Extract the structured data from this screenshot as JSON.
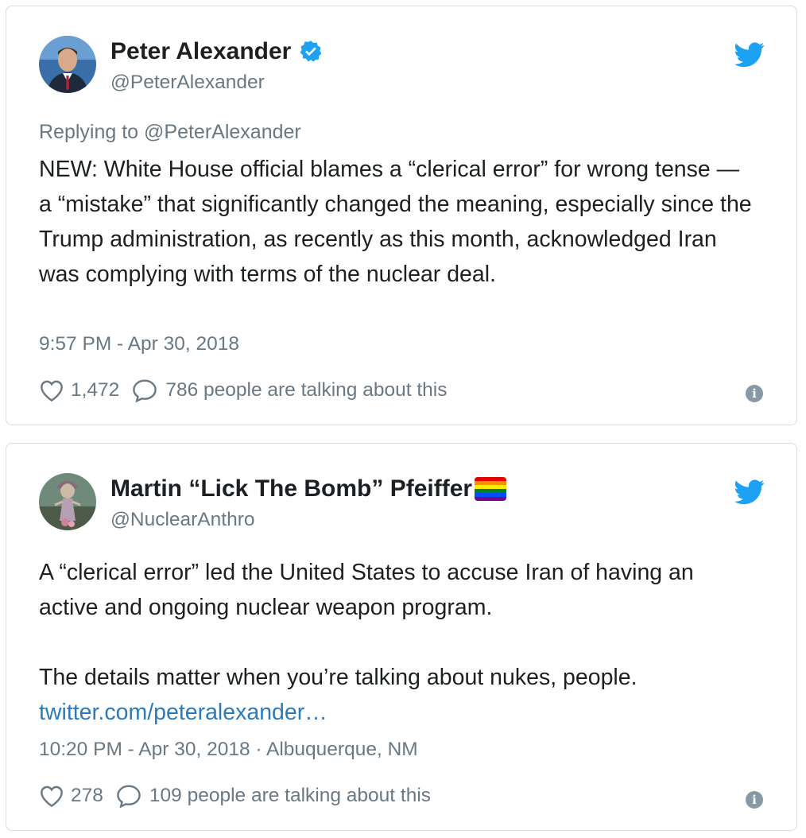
{
  "colors": {
    "twitter_blue": "#1da1f2",
    "verified_blue": "#1da1f2",
    "link": "#2b7bb9",
    "muted": "#697882",
    "text": "#1c2022",
    "border": "#d9dde0"
  },
  "tweets": [
    {
      "author_name": "Peter Alexander",
      "handle": "@PeterAlexander",
      "verified": true,
      "replying_to": "Replying to @PeterAlexander",
      "paragraphs": [
        "NEW: White House official blames a “clerical error” for wrong tense — a “mistake” that significantly changed the meaning, especially since the Trump administration, as recently as this month, acknowledged Iran was complying with terms of the nuclear deal."
      ],
      "timestamp": "9:57 PM - Apr 30, 2018",
      "likes": "1,472",
      "talking": "786 people are talking about this",
      "icons": [
        "avatar",
        "verified-badge-icon",
        "twitter-bird-icon",
        "heart-icon",
        "reply-bubble-icon",
        "info-icon"
      ]
    },
    {
      "author_name": "Martin “Lick The Bomb” Pfeiffer",
      "handle": "@NuclearAnthro",
      "verified": false,
      "paragraphs": [
        "A “clerical error” led the United States to accuse Iran of having an active and ongoing nuclear weapon program.",
        "The details matter when you’re talking about nukes, people."
      ],
      "link": "twitter.com/peteralexander…",
      "timestamp": "10:20 PM - Apr 30, 2018 · Albuquerque, NM",
      "likes": "278",
      "talking": "109 people are talking about this",
      "icons": [
        "avatar",
        "rainbow-flag-icon",
        "twitter-bird-icon",
        "heart-icon",
        "reply-bubble-icon",
        "info-icon"
      ]
    }
  ]
}
